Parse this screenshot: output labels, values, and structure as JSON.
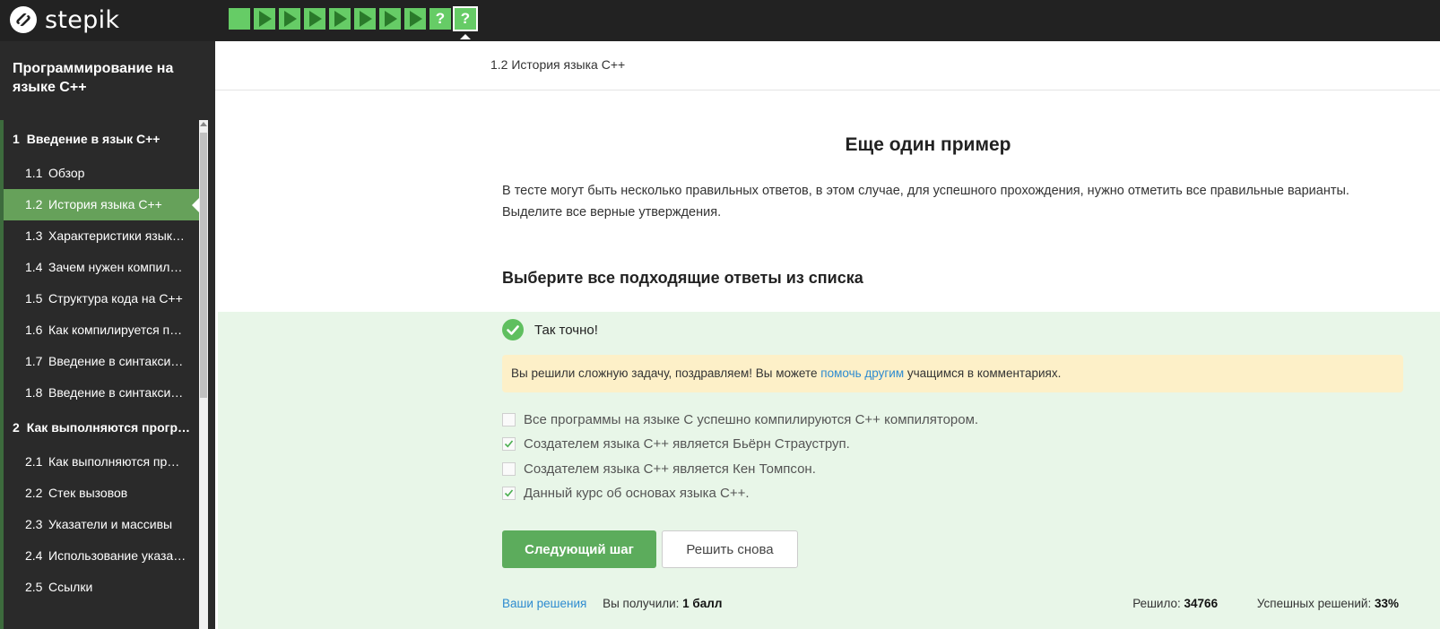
{
  "app": {
    "brand": "stepik"
  },
  "steps": [
    {
      "type": "text"
    },
    {
      "type": "video"
    },
    {
      "type": "video"
    },
    {
      "type": "video"
    },
    {
      "type": "video"
    },
    {
      "type": "video"
    },
    {
      "type": "video"
    },
    {
      "type": "video"
    },
    {
      "type": "quiz",
      "label": "?"
    },
    {
      "type": "quiz",
      "label": "?",
      "active": true
    }
  ],
  "sidebar": {
    "course_title": "Программирование на языке С++",
    "modules": [
      {
        "number": "1",
        "title": "Введение в язык С++",
        "lessons": [
          {
            "number": "1.1",
            "title": "Обзор"
          },
          {
            "number": "1.2",
            "title": "История языка С++",
            "active": true
          },
          {
            "number": "1.3",
            "title": "Характеристики язык…"
          },
          {
            "number": "1.4",
            "title": "Зачем нужен компил…"
          },
          {
            "number": "1.5",
            "title": "Структура кода на С++"
          },
          {
            "number": "1.6",
            "title": "Как компилируется п…"
          },
          {
            "number": "1.7",
            "title": "Введение в синтакси…"
          },
          {
            "number": "1.8",
            "title": "Введение в синтакси…"
          }
        ]
      },
      {
        "number": "2",
        "title": "Как выполняются прогр…",
        "lessons": [
          {
            "number": "2.1",
            "title": "Как выполняются пр…"
          },
          {
            "number": "2.2",
            "title": "Стек вызовов"
          },
          {
            "number": "2.3",
            "title": "Указатели и массивы"
          },
          {
            "number": "2.4",
            "title": "Использование указа…"
          },
          {
            "number": "2.5",
            "title": "Ссылки"
          }
        ]
      }
    ]
  },
  "lesson": {
    "breadcrumb": "1.2 История языка С++"
  },
  "step": {
    "title": "Еще один пример",
    "description": "В тесте могут быть несколько правильных ответов, в этом случае, для успешного прохождения, нужно отметить все правильные варианты. Выделите все верные утверждения.",
    "quiz_title": "Выберите все подходящие ответы из списка"
  },
  "feedback": {
    "status": "Так точно!",
    "hint_before": "Вы решили сложную задачу, поздравляем! Вы можете ",
    "hint_link": "помочь другим",
    "hint_after": " учащимся в комментариях.",
    "colors": {
      "success": "#5fbf5f",
      "panel": "#e8f6e8",
      "hint_bg": "#fdf0c8",
      "link": "#2e8bd0"
    }
  },
  "options": [
    {
      "label": "Все программы на языке С успешно компилируются С++ компилятором.",
      "checked": false
    },
    {
      "label": "Создателем языка С++ является Бьёрн Страуструп.",
      "checked": true
    },
    {
      "label": "Создателем языка С++ является Кен Томпсон.",
      "checked": false
    },
    {
      "label": "Данный курс об основах языка С++.",
      "checked": true
    }
  ],
  "buttons": {
    "next": "Следующий шаг",
    "retry": "Решить снова"
  },
  "footer": {
    "solutions_link": "Ваши решения",
    "score_label": "Вы получили: ",
    "score_value": "1 балл",
    "solved_label": "Решило: ",
    "solved_value": "34766",
    "success_label": "Успешных решений: ",
    "success_value": "33%"
  }
}
